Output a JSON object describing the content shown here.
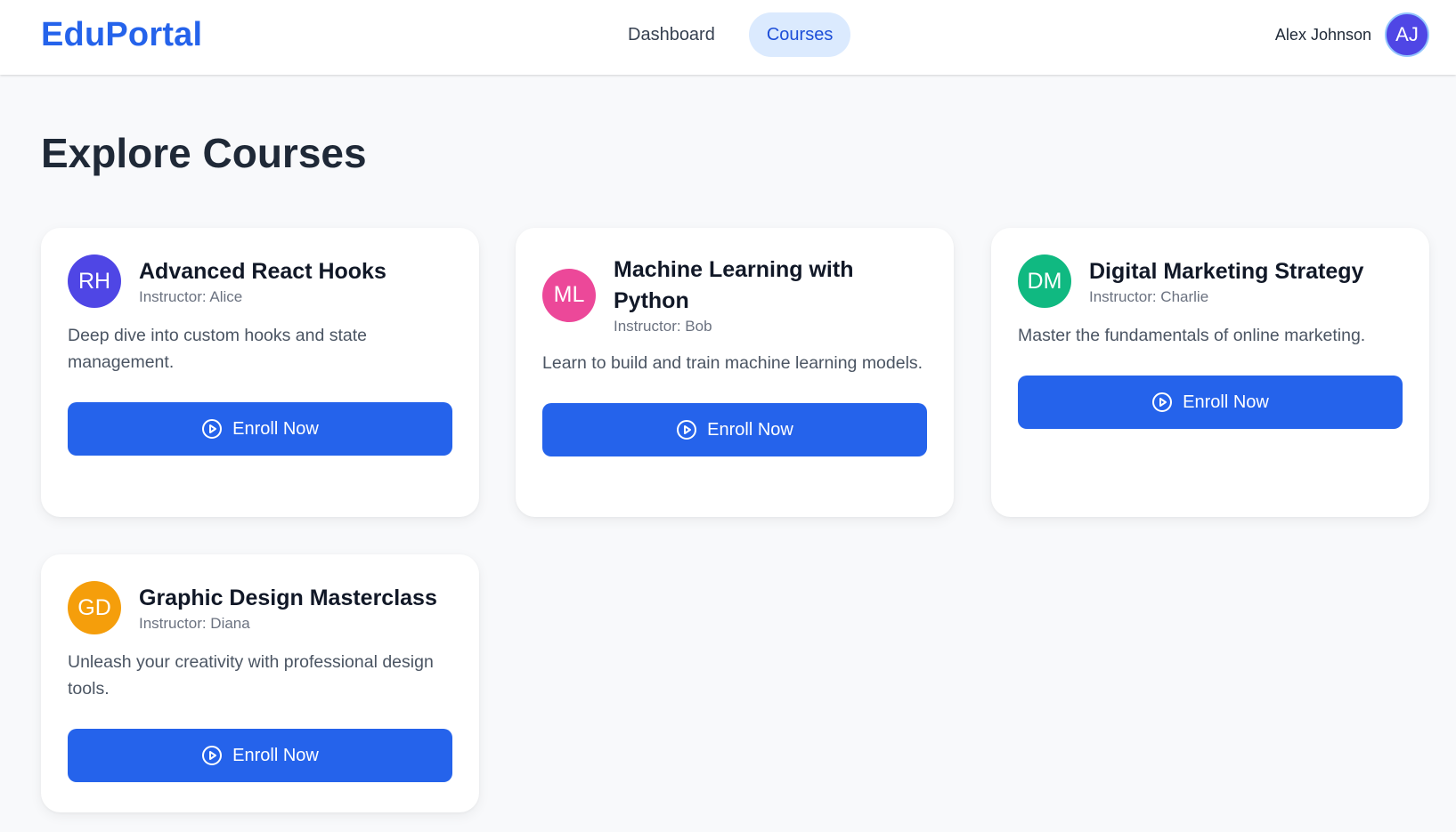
{
  "header": {
    "logo": "EduPortal",
    "nav": [
      {
        "label": "Dashboard",
        "active": false
      },
      {
        "label": "Courses",
        "active": true
      }
    ],
    "user": {
      "name": "Alex Johnson",
      "initials": "AJ",
      "avatar_color": "#4f46e5"
    }
  },
  "page_title": "Explore Courses",
  "courses": [
    {
      "initials": "RH",
      "avatar_color": "#4f46e5",
      "title": "Advanced React Hooks",
      "instructor": "Instructor: Alice",
      "description": "Deep dive into custom hooks and state management.",
      "button_label": "Enroll Now",
      "button_icon": "play-circle-icon"
    },
    {
      "initials": "ML",
      "avatar_color": "#ec4899",
      "title": "Machine Learning with Python",
      "instructor": "Instructor: Bob",
      "description": "Learn to build and train machine learning models.",
      "button_label": "Enroll Now",
      "button_icon": "play-circle-icon"
    },
    {
      "initials": "DM",
      "avatar_color": "#10b981",
      "title": "Digital Marketing Strategy",
      "instructor": "Instructor: Charlie",
      "description": "Master the fundamentals of online marketing.",
      "button_label": "Enroll Now",
      "button_icon": "play-circle-icon"
    },
    {
      "initials": "GD",
      "avatar_color": "#f59e0b",
      "title": "Graphic Design Masterclass",
      "instructor": "Instructor: Diana",
      "description": "Unleash your creativity with professional design tools.",
      "button_label": "Enroll Now",
      "button_icon": "play-circle-icon"
    }
  ],
  "colors": {
    "brand": "#2563eb",
    "nav_active_bg": "#dbeafe",
    "page_bg": "#f8f9fb"
  }
}
